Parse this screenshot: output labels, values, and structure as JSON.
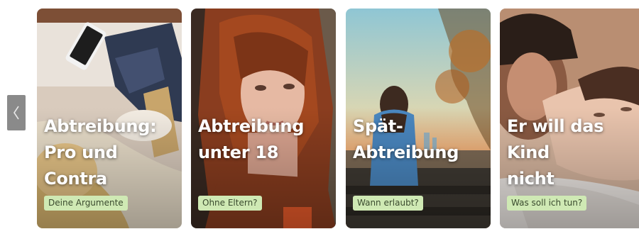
{
  "carousel": {
    "prev_icon": "chevron-left-icon",
    "cards": [
      {
        "title": "Abtreibung:\nPro und\nContra",
        "tag": "Deine Argumente"
      },
      {
        "title": "Abtreibung\nunter 18",
        "tag": "Ohne Eltern?"
      },
      {
        "title": "Spät-\nAbtreibung",
        "tag": "Wann erlaubt?"
      },
      {
        "title": "Er will das Kind\nnicht",
        "tag": "Was soll ich tun?"
      }
    ],
    "colors": {
      "tag_bg": "#cfe9b4",
      "tag_text": "#3a4a2e",
      "arrow_bg": "#8a8a8a"
    }
  }
}
